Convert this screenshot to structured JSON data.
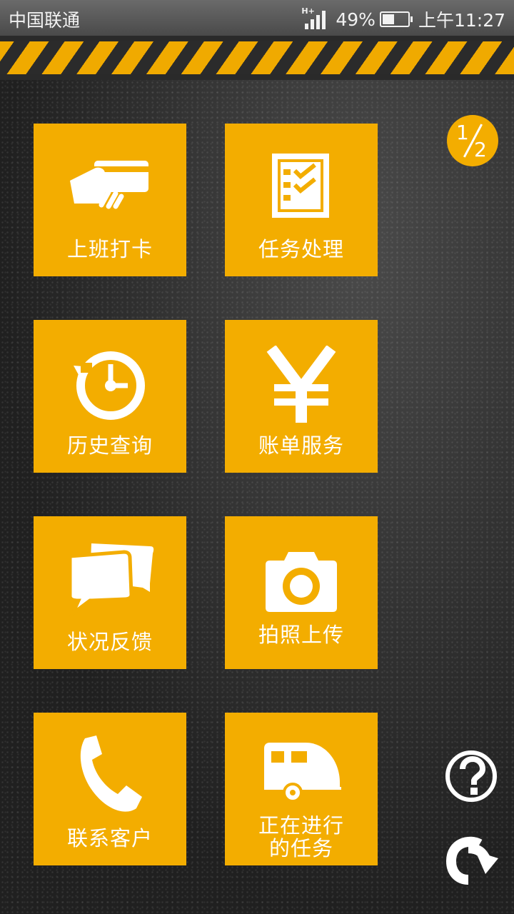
{
  "status_bar": {
    "carrier": "中国联通",
    "network": "H+",
    "battery": "49%",
    "time": "上午11:27"
  },
  "pager": {
    "current": "1",
    "total": "2"
  },
  "tiles": [
    {
      "label": "上班打卡",
      "icon": "card-swipe-icon"
    },
    {
      "label": "任务处理",
      "icon": "checklist-icon"
    },
    {
      "label": "历史查询",
      "icon": "history-clock-icon"
    },
    {
      "label": "账单服务",
      "icon": "yen-icon"
    },
    {
      "label": "状况反馈",
      "icon": "chat-bubbles-icon"
    },
    {
      "label": "拍照上传",
      "icon": "camera-icon"
    },
    {
      "label": "联系客户",
      "icon": "phone-icon"
    },
    {
      "label_line1": "正在进行",
      "label_line2": "的任务",
      "icon": "caravan-icon"
    }
  ],
  "side_buttons": [
    {
      "icon": "help-icon"
    },
    {
      "icon": "refresh-icon"
    }
  ],
  "colors": {
    "accent": "#f3ad00",
    "background": "#1e1e1e",
    "icon": "#ffffff"
  }
}
